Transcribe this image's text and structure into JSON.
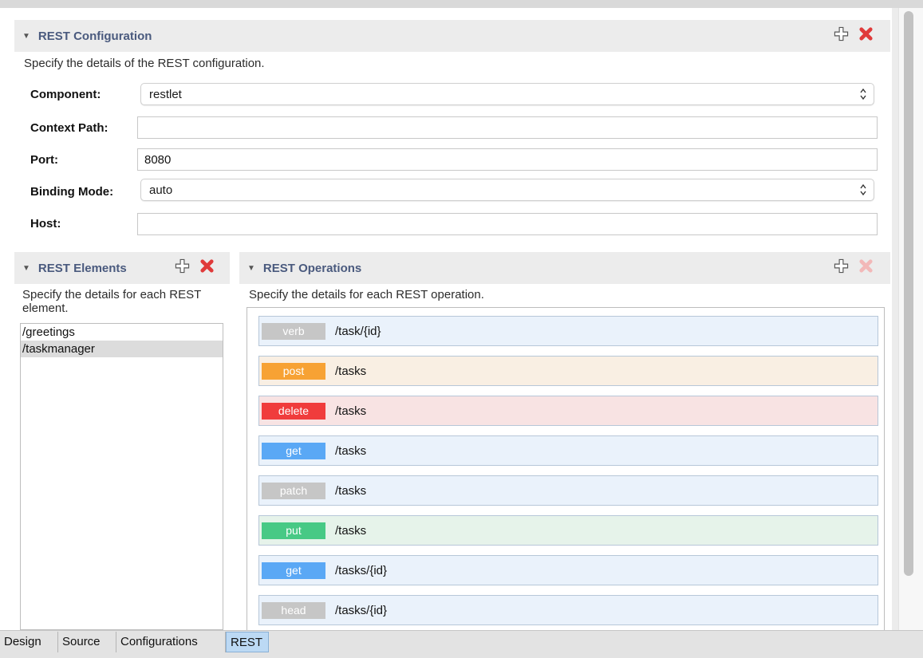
{
  "rest_configuration": {
    "title": "REST Configuration",
    "description": "Specify the details of the REST configuration.",
    "fields": {
      "component": {
        "label": "Component:",
        "value": "restlet"
      },
      "context_path": {
        "label": "Context Path:",
        "value": ""
      },
      "port": {
        "label": "Port:",
        "value": "8080"
      },
      "binding_mode": {
        "label": "Binding Mode:",
        "value": "auto"
      },
      "host": {
        "label": "Host:",
        "value": ""
      }
    }
  },
  "rest_elements": {
    "title": "REST Elements",
    "description": "Specify the details for each REST element.",
    "items": [
      "/greetings",
      "/taskmanager"
    ],
    "selected_index": 1
  },
  "rest_operations": {
    "title": "REST Operations",
    "description": "Specify the details for each REST operation.",
    "operations": [
      {
        "verb": "verb",
        "path": "/task/{id}",
        "badge_color": "#c6c6c6",
        "row_color": "#eaf2fb"
      },
      {
        "verb": "post",
        "path": "/tasks",
        "badge_color": "#f7a234",
        "row_color": "#f9efe3"
      },
      {
        "verb": "delete",
        "path": "/tasks",
        "badge_color": "#f03c3c",
        "row_color": "#f8e3e3"
      },
      {
        "verb": "get",
        "path": "/tasks",
        "badge_color": "#5aa8f5",
        "row_color": "#eaf2fb"
      },
      {
        "verb": "patch",
        "path": "/tasks",
        "badge_color": "#c6c6c6",
        "row_color": "#eaf2fb"
      },
      {
        "verb": "put",
        "path": "/tasks",
        "badge_color": "#47c985",
        "row_color": "#e6f3ea"
      },
      {
        "verb": "get",
        "path": "/tasks/{id}",
        "badge_color": "#5aa8f5",
        "row_color": "#eaf2fb"
      },
      {
        "verb": "head",
        "path": "/tasks/{id}",
        "badge_color": "#c6c6c6",
        "row_color": "#eaf2fb"
      }
    ]
  },
  "tabs": [
    {
      "label": "Design",
      "active": false
    },
    {
      "label": "Source",
      "active": false
    },
    {
      "label": "Configurations",
      "active": false
    },
    {
      "label": "REST",
      "active": true
    }
  ],
  "colors": {
    "header_text": "#4a5a7e",
    "add_icon_fill": "#ffffff",
    "delete_icon": "#e03a3a",
    "delete_icon_disabled": "#f2b8b8",
    "active_tab": "#bcd9f4"
  }
}
